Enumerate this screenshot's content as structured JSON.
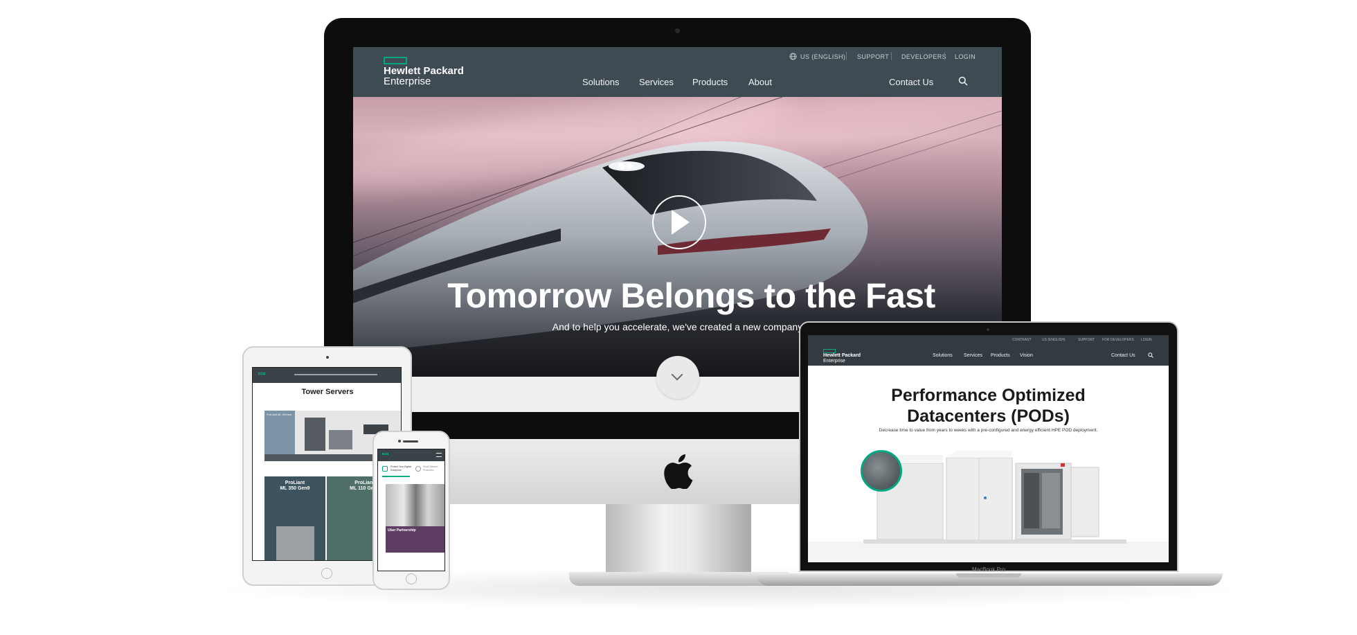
{
  "imac": {
    "utility_nav": {
      "region": "US (ENGLISH)",
      "support": "SUPPORT",
      "developers": "DEVELOPERS",
      "login": "LOGIN"
    },
    "logo": {
      "line1": "Hewlett Packard",
      "line2": "Enterprise"
    },
    "main_nav": [
      "Solutions",
      "Services",
      "Products",
      "About"
    ],
    "contact": "Contact Us",
    "hero": {
      "title": "Tomorrow Belongs to the Fast",
      "subtitle": "And to help you accelerate, we've created a new company"
    }
  },
  "macbook": {
    "device_label": "MacBook Pro",
    "utility_nav": [
      "CONTRAST",
      "US (ENGLISH)",
      "SUPPORT",
      "FOR DEVELOPERS",
      "LOGIN"
    ],
    "logo": {
      "line1": "Hewlett Packard",
      "line2": "Enterprise"
    },
    "main_nav": [
      "Solutions",
      "Services",
      "Products",
      "Vision"
    ],
    "contact": "Contact Us",
    "title_line1": "Performance Optimized",
    "title_line2": "Datacenters (PODs)",
    "subtitle": "Decrease time to value from years to weeks with a pre-configured and energy efficient HPE POD deployment."
  },
  "ipad": {
    "title": "Tower Servers",
    "banner_label": "ProLiant ML Servers",
    "card1": {
      "line1": "ProLiant",
      "line2": "ML 350 Gen9"
    },
    "card2": {
      "line1": "ProLiant",
      "line2": "ML 110 Gen9"
    }
  },
  "iphone": {
    "item1": "Protect Your Digital Enterprise",
    "item2": "Small Midsize Protection",
    "story_title": "Uber Partnership"
  },
  "colors": {
    "brand_green": "#01a982",
    "nav_bg": "#3f4b52"
  }
}
